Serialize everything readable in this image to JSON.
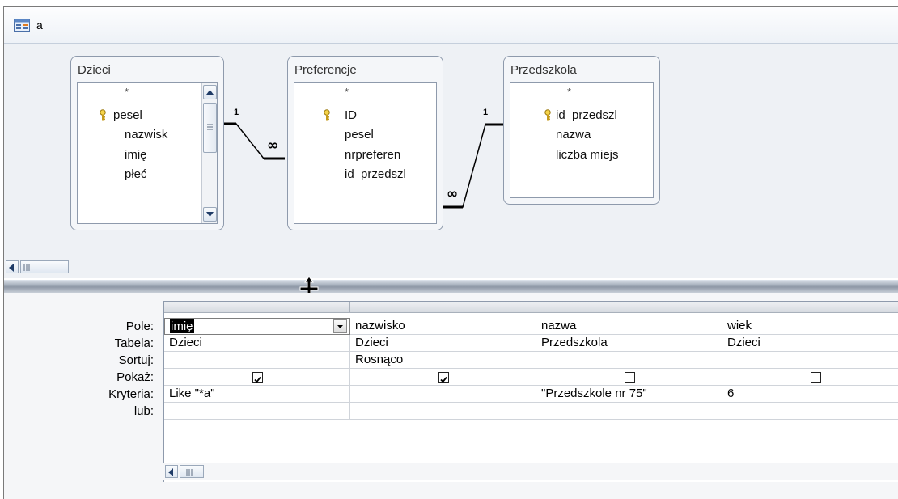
{
  "window": {
    "title": "a"
  },
  "tables": [
    {
      "name": "Dzieci",
      "fields": [
        "*",
        "pesel",
        "nazwisk",
        "imię",
        "płeć"
      ],
      "key_field_index": 1
    },
    {
      "name": "Preferencje",
      "fields": [
        "*",
        "ID",
        "pesel",
        "nrpreferen",
        "id_przedszl"
      ],
      "key_field_index": 1
    },
    {
      "name": "Przedszkola",
      "fields": [
        "*",
        "id_przedszl",
        "nazwa",
        "liczba miejs"
      ],
      "key_field_index": 1
    }
  ],
  "relations": [
    {
      "one_label": "1",
      "many_label": "∞"
    },
    {
      "one_label": "1",
      "many_label": "∞"
    }
  ],
  "grid": {
    "row_labels": [
      "Pole:",
      "Tabela:",
      "Sortuj:",
      "Pokaż:",
      "Kryteria:",
      "lub:"
    ],
    "columns": [
      {
        "pole": "imię",
        "tabela": "Dzieci",
        "sortuj": "",
        "pokaz": true,
        "kryteria": "Like \"*a\"",
        "lub": ""
      },
      {
        "pole": "nazwisko",
        "tabela": "Dzieci",
        "sortuj": "Rosnąco",
        "pokaz": true,
        "kryteria": "",
        "lub": ""
      },
      {
        "pole": "nazwa",
        "tabela": "Przedszkola",
        "sortuj": "",
        "pokaz": false,
        "kryteria": "\"Przedszkole nr 75\"",
        "lub": ""
      },
      {
        "pole": "wiek",
        "tabela": "Dzieci",
        "sortuj": "",
        "pokaz": false,
        "kryteria": "6",
        "lub": ""
      }
    ]
  },
  "icons": {
    "title": "query-design-icon",
    "key": "primary-key-icon",
    "splitter": "resize-cursor-icon",
    "scroll_left": "scroll-left-icon",
    "dropdown": "dropdown-arrow-icon"
  },
  "colors": {
    "canvas": "#eef1f5",
    "border": "#8e9aac",
    "selection": "#000000"
  }
}
